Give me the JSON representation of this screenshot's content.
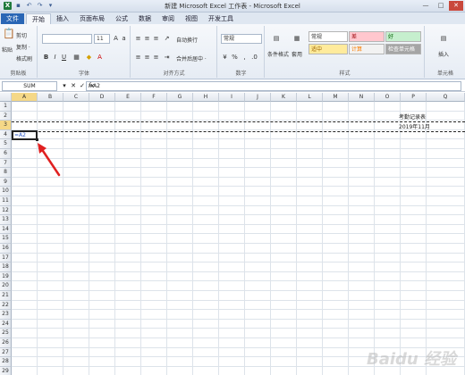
{
  "window": {
    "title": "新建 Microsoft Excel 工作表 - Microsoft Excel",
    "qat_icons": [
      "excel-logo-icon",
      "save-icon",
      "undo-icon",
      "redo-icon",
      "customize-qat-icon"
    ],
    "qat_glyphs": [
      "X",
      "▪",
      "↶",
      "↷",
      "▾"
    ],
    "controls": [
      "—",
      "□",
      "✕"
    ]
  },
  "ribbon_tabs": [
    {
      "label": "文件",
      "kind": "file"
    },
    {
      "label": "开始",
      "kind": "active"
    },
    {
      "label": "插入",
      "kind": ""
    },
    {
      "label": "页面布局",
      "kind": ""
    },
    {
      "label": "公式",
      "kind": ""
    },
    {
      "label": "数据",
      "kind": ""
    },
    {
      "label": "审阅",
      "kind": ""
    },
    {
      "label": "视图",
      "kind": ""
    },
    {
      "label": "开发工具",
      "kind": ""
    }
  ],
  "ribbon": {
    "clipboard": {
      "label": "剪贴板",
      "paste": "粘贴",
      "cut": "剪切",
      "copy": "复制 ·",
      "format_painter": "格式刷"
    },
    "font": {
      "label": "字体",
      "font_size": "11",
      "bold": "B",
      "italic": "I",
      "underline": "U"
    },
    "alignment": {
      "label": "对齐方式",
      "wrap": "自动换行",
      "merge": "合并后居中 ·"
    },
    "number": {
      "label": "数字",
      "format": "常规"
    },
    "styles": {
      "label": "样式",
      "conditional": "条件格式",
      "table": "套用",
      "cells": [
        "常规",
        "差",
        "好",
        "适中",
        "计算",
        "检查单元格"
      ]
    },
    "cells": {
      "label": "单元格",
      "insert": "插入"
    }
  },
  "formula_bar": {
    "name_box": "SUM",
    "icons": [
      "▾",
      "✕",
      "✓",
      "fx"
    ],
    "content": "=A2"
  },
  "sheet": {
    "columns": [
      "A",
      "B",
      "C",
      "D",
      "E",
      "F",
      "G",
      "H",
      "I",
      "J",
      "K",
      "L",
      "M",
      "N",
      "O",
      "P",
      "Q"
    ],
    "selected_column": "A",
    "selected_row": "3",
    "cells": {
      "O1": "考勤记录表",
      "O2": "2019年11月",
      "A3": "=A2"
    }
  },
  "colors": {
    "accent": "#2a66b5",
    "arrow": "#e02020",
    "selected_header": "#f5d887"
  },
  "watermark": "Baidu 经验"
}
